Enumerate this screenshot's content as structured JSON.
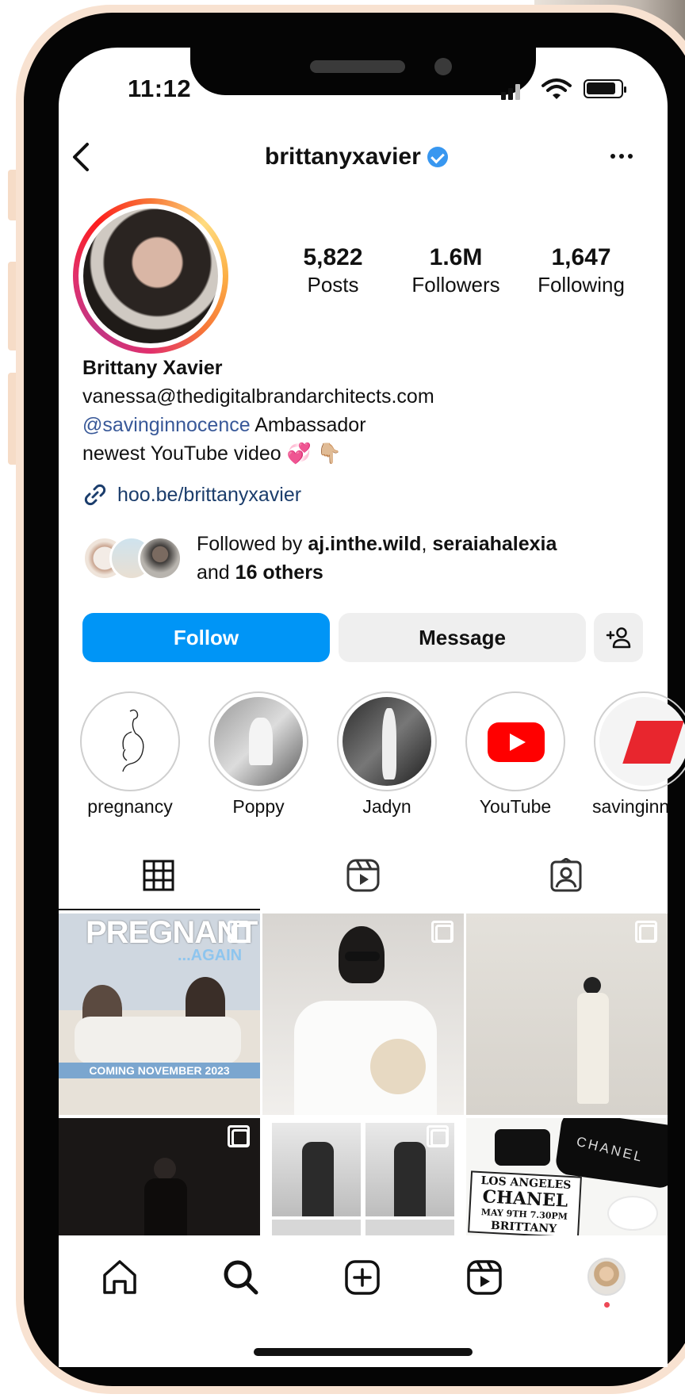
{
  "status_bar": {
    "time": "11:12"
  },
  "header": {
    "username": "brittanyxavier",
    "back_icon": "chevron-left-icon",
    "more_icon": "more-horizontal-icon"
  },
  "stats": [
    {
      "value": "5,822",
      "label": "Posts"
    },
    {
      "value": "1.6M",
      "label": "Followers"
    },
    {
      "value": "1,647",
      "label": "Following"
    }
  ],
  "bio": {
    "name": "Brittany Xavier",
    "email": "vanessa@thedigitalbrandarchitects.com",
    "mention": "@savinginnocence",
    "mention_suffix": " Ambassador",
    "line3": "newest YouTube video 💞 👇🏼",
    "link": "hoo.be/brittanyxavier"
  },
  "followed_by": {
    "prefix": "Followed by ",
    "user1": "aj.inthe.wild",
    "sep": ", ",
    "user2": "seraiahalexia",
    "and": "and ",
    "others": "16 others"
  },
  "actions": {
    "follow": "Follow",
    "message": "Message"
  },
  "highlights": [
    {
      "label": "pregnancy"
    },
    {
      "label": "Poppy"
    },
    {
      "label": "Jadyn"
    },
    {
      "label": "YouTube"
    },
    {
      "label": "savinginn"
    }
  ],
  "posts": {
    "tile1_title": "PREGNANT",
    "tile1_sub": "...AGAIN",
    "tile1_banner": "COMING NOVEMBER 2023",
    "tile6_brand": "CHANEL",
    "tile6_poster": [
      "LOS ANGELES",
      "CHANEL",
      "MAY 9TH 7.30PM",
      "BRITTANY"
    ]
  },
  "colors": {
    "follow_blue": "#0095f6",
    "link": "#1b3d6c",
    "verified": "#3897f0",
    "notification": "#ed4956"
  }
}
